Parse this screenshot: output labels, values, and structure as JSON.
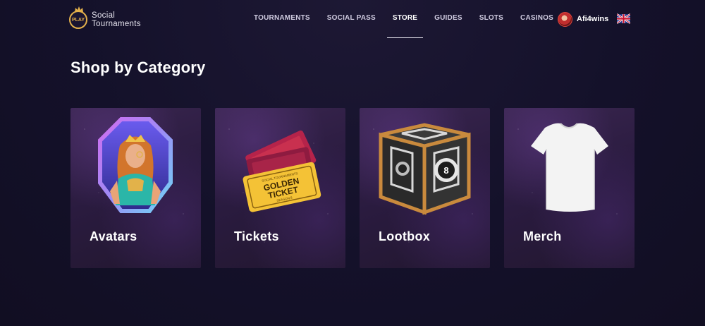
{
  "brand": {
    "badge_text": "PLAY",
    "name_line1": "Social",
    "name_line2": "Tournaments",
    "accent_color": "#e3b04b"
  },
  "nav": {
    "items": [
      {
        "label": "TOURNAMENTS",
        "active": false
      },
      {
        "label": "SOCIAL PASS",
        "active": false
      },
      {
        "label": "STORE",
        "active": true
      },
      {
        "label": "GUIDES",
        "active": false
      },
      {
        "label": "SLOTS",
        "active": false
      },
      {
        "label": "CASINOS",
        "active": false
      }
    ]
  },
  "user": {
    "username": "Afi4wins",
    "avatar_icon": "user-avatar",
    "language_icon": "uk-flag-icon"
  },
  "page": {
    "title": "Shop by Category"
  },
  "categories": [
    {
      "label": "Avatars",
      "icon": "avatar-octagon-image"
    },
    {
      "label": "Tickets",
      "icon": "golden-ticket-image",
      "ticket_top": "SOCIAL TOURNAMENTS",
      "ticket_main1": "GOLDEN",
      "ticket_main2": "TICKET",
      "ticket_sub": "SEASON 8"
    },
    {
      "label": "Lootbox",
      "icon": "lootbox-cube-image",
      "lootbox_number": "8"
    },
    {
      "label": "Merch",
      "icon": "tshirt-image"
    }
  ]
}
